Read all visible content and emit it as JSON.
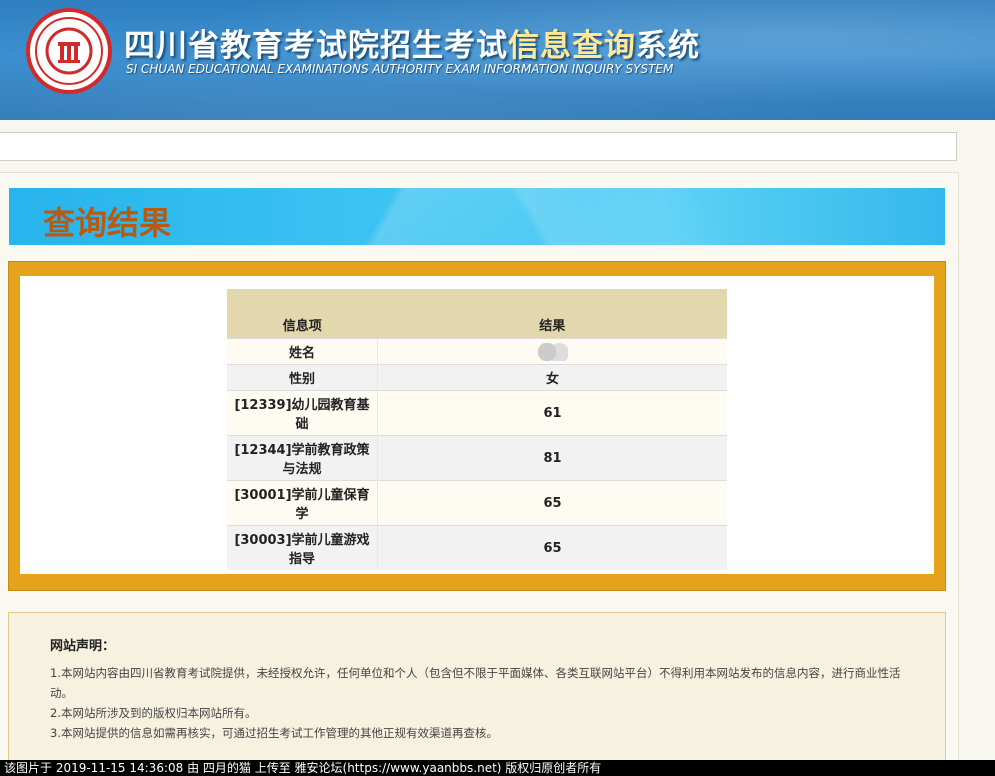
{
  "header": {
    "title_main": "四川省教育考试院招生考试",
    "title_highlight": "信息查询",
    "title_tail": "系统",
    "subtitle": "SI CHUAN EDUCATIONAL EXAMINATIONS AUTHORITY EXAM INFORMATION INQUIRY SYSTEM",
    "logo_icon": "sceea-emblem-icon"
  },
  "banner": {
    "title": "查询结果"
  },
  "results": {
    "header": {
      "item": "信息项",
      "result": "结果"
    },
    "rows": [
      {
        "item": "姓名",
        "result": ""
      },
      {
        "item": "性别",
        "result": "女"
      },
      {
        "item": "[12339]幼儿园教育基础",
        "result": "61"
      },
      {
        "item": "[12344]学前教育政策与法规",
        "result": "81"
      },
      {
        "item": "[30001]学前儿童保育学",
        "result": "65"
      },
      {
        "item": "[30003]学前儿童游戏指导",
        "result": "65"
      }
    ]
  },
  "notice": {
    "title": "网站声明：",
    "lines": [
      "1.本网站内容由四川省教育考试院提供，未经授权允许，任何单位和个人（包含但不限于平面媒体、各类互联网站平台）不得利用本网站发布的信息内容，进行商业性活动。",
      "2.本网站所涉及到的版权归本网站所有。",
      "3.本网站提供的信息如需再核实，可通过招生考试工作管理的其他正规有效渠道再查核。"
    ]
  },
  "watermark": "该图片于 2019-11-15 14:36:08 由 四月的猫 上传至 雅安论坛(https://www.yaanbbs.net) 版权归原创者所有",
  "colors": {
    "header_blue": "#2f7fc0",
    "title_highlight": "#ffe89a",
    "banner_title": "#b85a14",
    "frame_gold": "#e5a31c",
    "table_header": "#e2d7ad"
  }
}
